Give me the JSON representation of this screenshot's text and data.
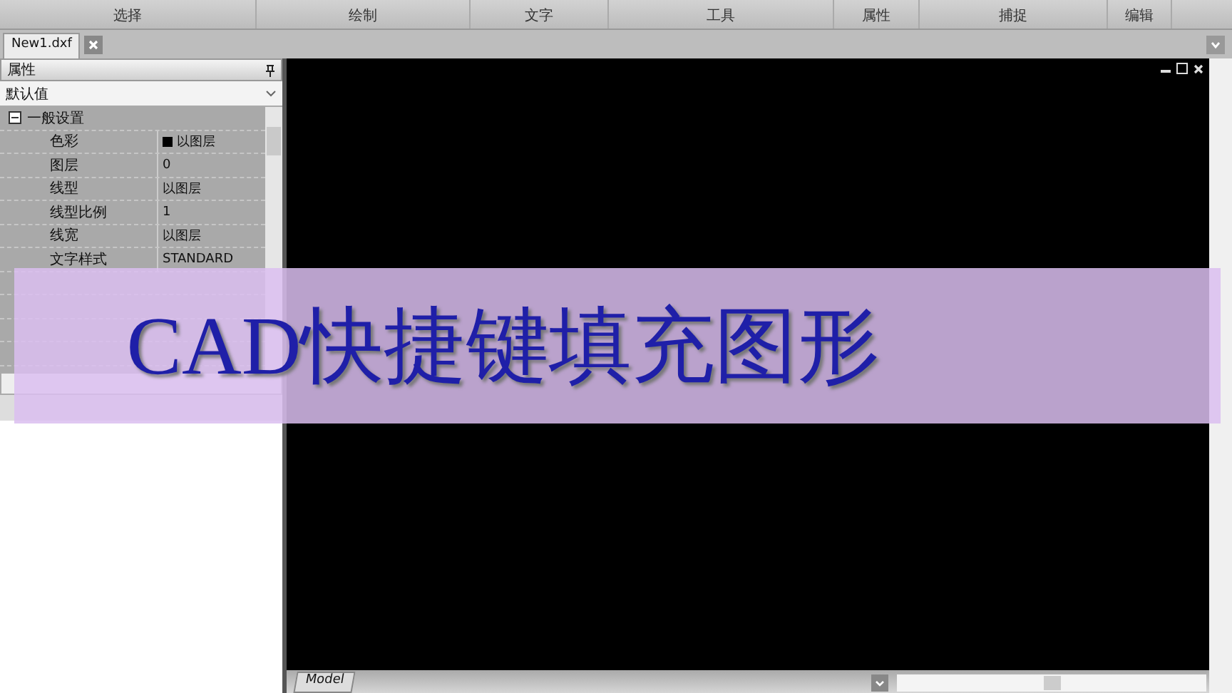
{
  "ribbon": {
    "groups": [
      "选择",
      "绘制",
      "文字",
      "工具",
      "属性",
      "捕捉",
      "编辑"
    ]
  },
  "document_tabs": [
    {
      "label": "New1.dxf",
      "selected": true
    }
  ],
  "properties_panel": {
    "title": "属性",
    "dropdown": "默认值",
    "group": {
      "label": "一般设置",
      "expanded": true
    },
    "rows": [
      {
        "name": "色彩",
        "value": "以图层",
        "kind": "color"
      },
      {
        "name": "图层",
        "value": "0",
        "kind": "text"
      },
      {
        "name": "线型",
        "value": "以图层",
        "kind": "text"
      },
      {
        "name": "线型比例",
        "value": "1",
        "kind": "text"
      },
      {
        "name": "线宽",
        "value": "以图层",
        "kind": "text"
      },
      {
        "name": "文字样式",
        "value": "STANDARD",
        "kind": "text"
      }
    ]
  },
  "layout_tabs": [
    {
      "label": "Model",
      "selected": true
    }
  ],
  "banner": {
    "text": "CAD快捷键填充图形"
  }
}
